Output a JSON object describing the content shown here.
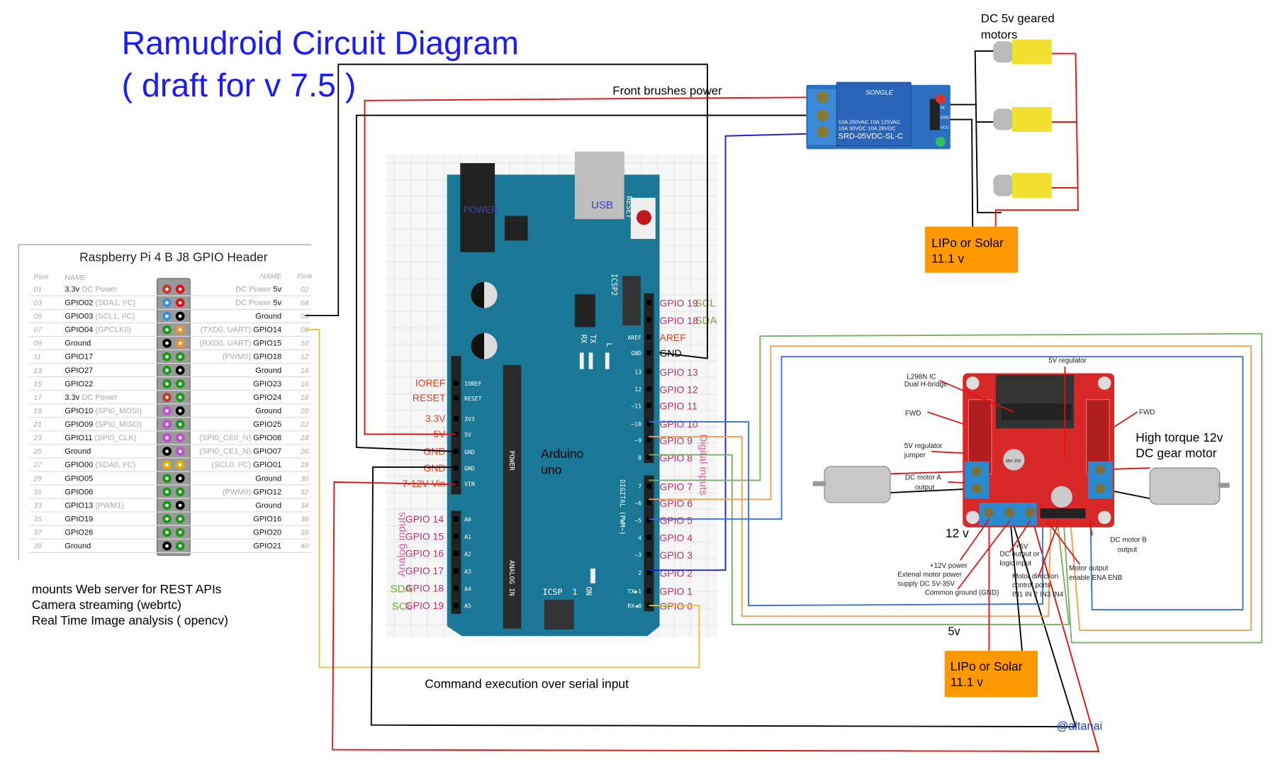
{
  "title": {
    "line1": "Ramudroid Circuit Diagram",
    "line2": "( draft for v 7.5 )",
    "color": "#1a1aff"
  },
  "rpi": {
    "title": "Raspberry Pi 4 B J8 GPIO Header",
    "headers": {
      "pin_left": "Pin#",
      "name_left": "NAME",
      "name_right": "NAME",
      "pin_right": "Pin#"
    },
    "rows": [
      [
        "01",
        "3.3v",
        "DC Power",
        "DC Power",
        "5v",
        "02",
        "#c0392b",
        "#e01010"
      ],
      [
        "03",
        "GPIO02",
        "(SDA1, I²C)",
        "DC Power",
        "5v",
        "04",
        "#3a8fd9",
        "#e01010"
      ],
      [
        "05",
        "GPIO03",
        "(SCL1, I²C)",
        "",
        "Ground",
        "06",
        "#3a8fd9",
        "#000000"
      ],
      [
        "07",
        "GPIO04",
        "(GPCLK0)",
        "(TXD0, UART)",
        "GPIO14",
        "08",
        "#1a9a1a",
        "#f0932b"
      ],
      [
        "09",
        "Ground",
        "",
        "(RXD0, UART)",
        "GPIO15",
        "10",
        "#000000",
        "#f0932b"
      ],
      [
        "11",
        "GPIO17",
        "",
        "(PWM0)",
        "GPIO18",
        "12",
        "#1a9a1a",
        "#1a9a1a"
      ],
      [
        "13",
        "GPIO27",
        "",
        "",
        "Ground",
        "14",
        "#1a9a1a",
        "#000000"
      ],
      [
        "15",
        "GPIO22",
        "",
        "",
        "GPIO23",
        "16",
        "#1a9a1a",
        "#1a9a1a"
      ],
      [
        "17",
        "3.3v",
        "DC Power",
        "",
        "GPIO24",
        "18",
        "#c0392b",
        "#1a9a1a"
      ],
      [
        "19",
        "GPIO10",
        "(SPI0_MOSI)",
        "",
        "Ground",
        "20",
        "#c04fd0",
        "#000000"
      ],
      [
        "21",
        "GPIO09",
        "(SPI0_MISO)",
        "",
        "GPIO25",
        "22",
        "#c04fd0",
        "#1a9a1a"
      ],
      [
        "23",
        "GPIO11",
        "(SPI0_CLK)",
        "(SPI0_CE0_N)",
        "GPIO08",
        "24",
        "#c04fd0",
        "#c04fd0"
      ],
      [
        "25",
        "Ground",
        "",
        "(SPI0_CE1_N)",
        "GPIO07",
        "26",
        "#000000",
        "#c04fd0"
      ],
      [
        "27",
        "GPIO00",
        "(SDA0, I²C)",
        "(SCL0, I²C)",
        "GPIO01",
        "28",
        "#e0b000",
        "#e0b000"
      ],
      [
        "29",
        "GPIO05",
        "",
        "",
        "Ground",
        "30",
        "#1a9a1a",
        "#000000"
      ],
      [
        "31",
        "GPIO06",
        "",
        "(PWM0)",
        "GPIO12",
        "32",
        "#1a9a1a",
        "#1a9a1a"
      ],
      [
        "33",
        "GPIO13",
        "(PWM1)",
        "",
        "Ground",
        "34",
        "#1a9a1a",
        "#000000"
      ],
      [
        "35",
        "GPIO19",
        "",
        "",
        "GPIO16",
        "36",
        "#1a9a1a",
        "#1a9a1a"
      ],
      [
        "37",
        "GPIO26",
        "",
        "",
        "GPIO20",
        "38",
        "#1a9a1a",
        "#1a9a1a"
      ],
      [
        "39",
        "Ground",
        "",
        "",
        "GPIO21",
        "40",
        "#000000",
        "#1a9a1a"
      ]
    ]
  },
  "notes": [
    "mounts  Web server for REST APIs",
    "Camera streaming (webrtc)",
    "Real Time Image analysis ( opencv)"
  ],
  "arduino": {
    "label_line1": "Arduino",
    "label_line2": "uno",
    "power_jack": "POWER",
    "usb": "USB",
    "reset": "RESET",
    "icsp2": "ICSP2",
    "icsp": "ICSP",
    "tx": "TX",
    "rx": "RX",
    "led_l": "L",
    "on": "ON",
    "one": "1",
    "power_group": "POWER",
    "analog_group": "ANALOG IN",
    "digital_group": "DIGITAL (PWM~)",
    "analog_title": "Analog inputs",
    "digital_title": "Digital inputs",
    "left_power_labels": [
      "IOREF",
      "RESET",
      "3.3V",
      "5V",
      "GND",
      "GND",
      "7-12V Vin"
    ],
    "left_power_silk": [
      "IOREF",
      "RESET",
      "3V3",
      "5V",
      "GND",
      "GND",
      "VIN"
    ],
    "analog_labels": [
      "GPIO 14",
      "GPIO 15",
      "GPIO 16",
      "GPIO 17",
      "GPIO 18",
      "GPIO 19"
    ],
    "analog_silk": [
      "A0",
      "A1",
      "A2",
      "A3",
      "A4",
      "A5"
    ],
    "analog_extra": {
      "sda": "SDA",
      "scl": "SCL"
    },
    "right_labels": [
      "GPIO 19",
      "GPIO 18",
      "AREF",
      "GND",
      "GPIO 13",
      "GPIO 12",
      "GPIO 11",
      "GPIO 10",
      "GPIO 9",
      "GPIO 8",
      "GPIO 7",
      "GPIO 6",
      "GPIO 5",
      "GPIO 4",
      "GPIO 3",
      "GPIO 2",
      "GPIO 1",
      "GPIO 0"
    ],
    "right_silk": [
      "",
      "",
      "AREF",
      "GND",
      "13",
      "12",
      "~11",
      "~10",
      "~9",
      "8",
      "7",
      "~6",
      "~5",
      "4",
      "~3",
      "2",
      "TX▶1",
      "RX◀0"
    ],
    "right_extra": {
      "scl": "SCL",
      "sda": "SDA"
    },
    "colors": {
      "board": "#1a7896",
      "pin_label": "#b5336c",
      "power_label": "#e0401e",
      "i2c": "#7aa33a"
    }
  },
  "relay": {
    "brand": "SONGLE",
    "rating1": "10A 250VAC  10A 125VAC",
    "rating2": "10A  30VDC  10A  28VDC",
    "model": "SRD-05VDC-SL-C",
    "pins": [
      "IN",
      "GND",
      "VCC"
    ]
  },
  "labels": {
    "front_brushes": "Front brushes power",
    "geared_motors_1": "DC 5v geared",
    "geared_motors_2": "motors",
    "battery_top_1": "LIPo or Solar",
    "battery_top_2": "11.1 v",
    "battery_bottom_1": "LIPo or Solar",
    "battery_bottom_2": "11.1 v",
    "serial": "Command execution over serial input",
    "high_torque_1": "High torque 12v",
    "high_torque_2": "DC gear motor",
    "twelve_v": "12 v",
    "five_v": "5v",
    "credit": "@altanai"
  },
  "l298n": {
    "ic_1": "L298N IC",
    "ic_2": "Dual H-bridge",
    "regulator": "5V regulator",
    "fwd_left": "FWD",
    "fwd_right": "FWD",
    "jumper_1": "5V regulator",
    "jumper_2": "jumper",
    "motor_a_1": "DC motor A",
    "motor_a_2": "output",
    "motor_b_1": "DC motor B",
    "motor_b_2": "output",
    "power_1": "+12V power",
    "power_2": "Extenal motor power",
    "power_3": "supply DC 5V-35V",
    "gnd": "Common ground (GND)",
    "logic_1": "+5V",
    "logic_2": "DC output or",
    "logic_3": "logic input",
    "dir_1": "Motor direction",
    "dir_2": "control ports",
    "dir_3": "IN1 IN 2 IN3 IN4",
    "enable_1": "Motor output",
    "enable_2": "enable ENA ENB",
    "cap": "35V 220"
  },
  "colors": {
    "battery": "#ff9900",
    "wire_red": "#e01010",
    "wire_black": "#000000",
    "wire_blue": "#1a3fd0",
    "wire_green": "#77b060",
    "wire_orange": "#f0a050",
    "wire_yellow": "#e8c040",
    "l298n": "#d82828",
    "relay": "#2a6fc0"
  }
}
